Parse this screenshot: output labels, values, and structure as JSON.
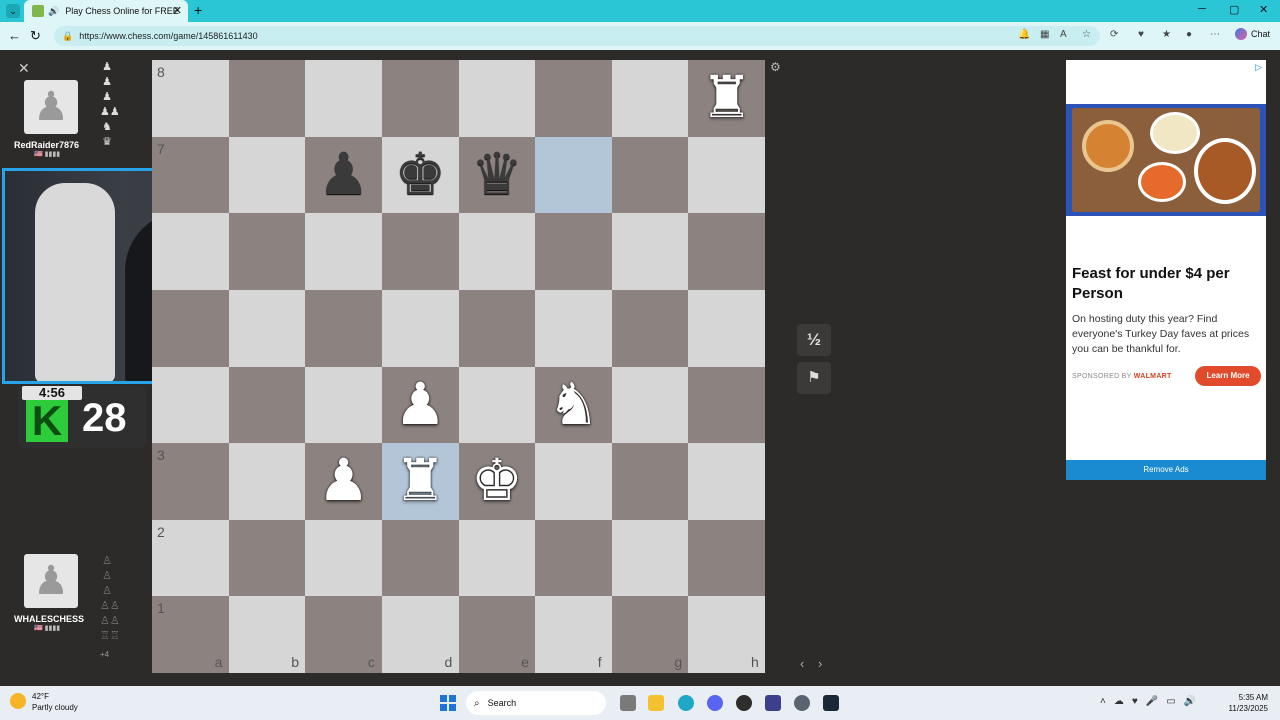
{
  "browser": {
    "tab_title": "Play Chess Online for FREE",
    "url": "https://www.chess.com/game/145861611430",
    "chat_label": "Chat"
  },
  "players": {
    "top": {
      "name": "RedRaider7876",
      "flag_rating": "🇺🇸 ▮▮▮▮",
      "captured": [
        "♟",
        "♟",
        "♟",
        "♟♟",
        "♞",
        "♛"
      ]
    },
    "bottom": {
      "name": "WHALESCHESS",
      "flag_rating": "🇺🇸 ▮▮▮▮",
      "captured": [
        "♙",
        "♙",
        "♙",
        "♙♙",
        "♙♙",
        "♖♖"
      ],
      "advantage": "+4"
    }
  },
  "stream_overlay": {
    "timer": "4:56",
    "streak_letter": "K",
    "streak_count": "28"
  },
  "board": {
    "ranks": [
      "8",
      "7",
      "3",
      "2",
      "1"
    ],
    "files": [
      "a",
      "b",
      "c",
      "d",
      "e",
      "f",
      "g",
      "h"
    ],
    "pieces": [
      {
        "square": "h8",
        "glyph": "♜",
        "color": "white",
        "name": "white-rook"
      },
      {
        "square": "c7",
        "glyph": "♟",
        "color": "black",
        "name": "black-pawn"
      },
      {
        "square": "d7",
        "glyph": "♚",
        "color": "black",
        "name": "black-king"
      },
      {
        "square": "e7",
        "glyph": "♛",
        "color": "black",
        "name": "black-queen"
      },
      {
        "square": "d4",
        "glyph": "♟",
        "color": "white",
        "name": "white-pawn"
      },
      {
        "square": "f4",
        "glyph": "♞",
        "color": "white",
        "name": "white-knight"
      },
      {
        "square": "c3",
        "glyph": "♟",
        "color": "white",
        "name": "white-pawn"
      },
      {
        "square": "d3",
        "glyph": "♜",
        "color": "white",
        "name": "white-rook"
      },
      {
        "square": "e3",
        "glyph": "♚",
        "color": "white",
        "name": "white-king"
      }
    ],
    "highlight_squares": [
      "f7",
      "d3"
    ]
  },
  "controls": {
    "draw_label": "½",
    "resign_icon": "flag-icon",
    "prev": "‹",
    "next": "›"
  },
  "ad": {
    "headline": "Feast for under $4 per Person",
    "body": "On hosting duty this year? Find everyone's Turkey Day faves at prices you can be thankful for.",
    "sponsor_prefix": "SPONSORED BY ",
    "sponsor_name": "WALMART",
    "cta": "Learn More",
    "remove_ads": "Remove Ads"
  },
  "taskbar": {
    "weather_temp": "42°F",
    "weather_desc": "Partly cloudy",
    "search_label": "Search",
    "time": "5:35 AM",
    "date": "11/23/2025"
  }
}
